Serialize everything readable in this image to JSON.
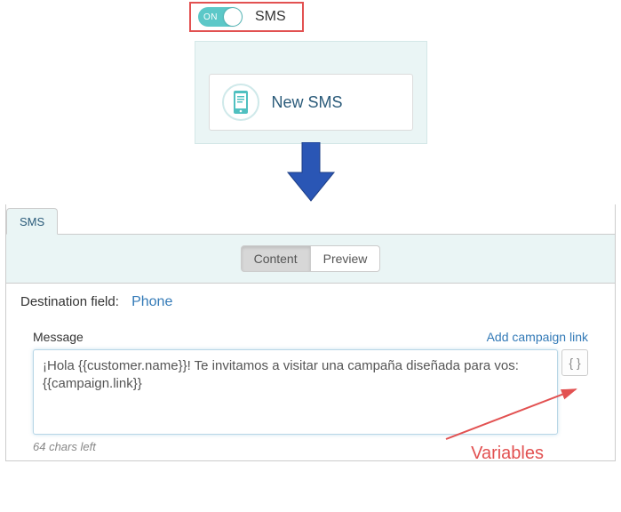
{
  "toggle": {
    "state": "ON",
    "label": "SMS"
  },
  "card": {
    "title": "New SMS"
  },
  "tabs": {
    "sms": "SMS"
  },
  "segments": {
    "content": "Content",
    "preview": "Preview"
  },
  "destination": {
    "label": "Destination field:",
    "value": "Phone"
  },
  "message": {
    "label": "Message",
    "add_link": "Add campaign link",
    "value": "¡Hola {{customer.name}}! Te invitamos a visitar una campaña diseñada para vos: {{campaign.link}}",
    "var_button": "{ }",
    "chars_left": "64 chars left"
  },
  "annotation": {
    "variables": "Variables"
  }
}
